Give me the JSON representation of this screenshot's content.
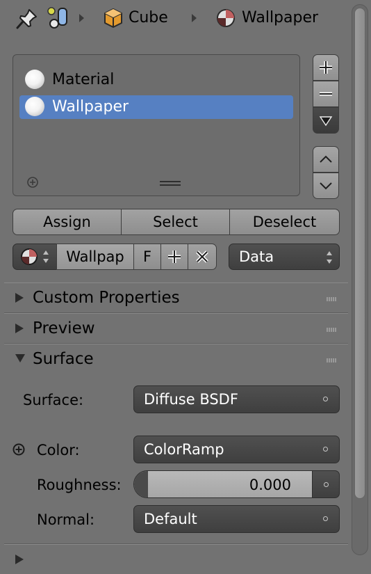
{
  "header": {
    "object_name": "Cube",
    "material_name": "Wallpaper"
  },
  "material_slots": {
    "items": [
      {
        "label": "Material",
        "selected": false
      },
      {
        "label": "Wallpaper",
        "selected": true
      }
    ]
  },
  "slot_actions": {
    "assign": "Assign",
    "select": "Select",
    "deselect": "Deselect"
  },
  "datablock": {
    "name": "Wallpap",
    "fake_user": "F",
    "link": "Data"
  },
  "panels": {
    "custom_properties": "Custom Properties",
    "preview": "Preview",
    "surface": "Surface"
  },
  "surface": {
    "surface_label": "Surface:",
    "surface_value": "Diffuse BSDF",
    "color_label": "Color:",
    "color_value": "ColorRamp",
    "roughness_label": "Roughness:",
    "roughness_value": "0.000",
    "normal_label": "Normal:",
    "normal_value": "Default"
  },
  "colors": {
    "background": "#727272",
    "selection": "#5680c2",
    "field_dark": "#464646",
    "accent_orange": "#e8a23a"
  }
}
